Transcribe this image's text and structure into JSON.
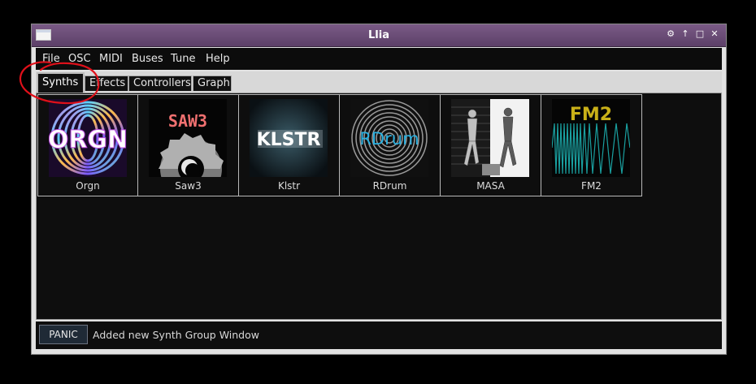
{
  "window": {
    "title": "Llia"
  },
  "menu": [
    "File",
    "OSC",
    "MIDI",
    "Buses",
    "Tune",
    "Help"
  ],
  "tabs": [
    "Synths",
    "Effects",
    "Controllers",
    "Graph"
  ],
  "active_tab": "Synths",
  "synths": [
    {
      "label": "Orgn",
      "thumb_text": "ORGN"
    },
    {
      "label": "Saw3",
      "thumb_text": "SAW3"
    },
    {
      "label": "Klstr",
      "thumb_text": "KLSTR"
    },
    {
      "label": "RDrum",
      "thumb_text": "RDrum"
    },
    {
      "label": "MASA",
      "thumb_text": ""
    },
    {
      "label": "FM2",
      "thumb_text": "FM2"
    }
  ],
  "status": {
    "panic_label": "PANIC",
    "message": "Added new Synth Group Window"
  },
  "colors": {
    "titlebar": "#6b4c78",
    "annotation": "#e0101a",
    "saw3_text": "#f07070",
    "rdrum_text": "#2ab0e0",
    "fm2_text": "#c9b018",
    "fm2_wave": "#1aa0a0"
  }
}
